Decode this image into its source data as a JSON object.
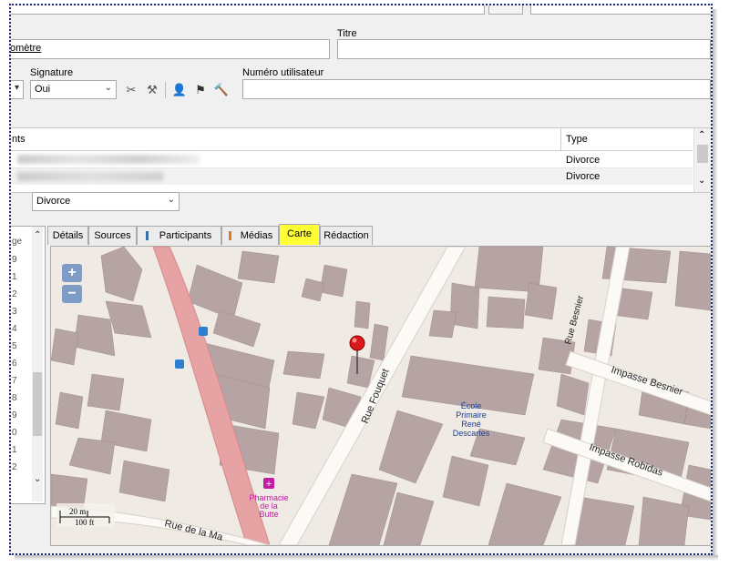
{
  "form": {
    "field_partial_value": "omètre",
    "titre_label": "Titre",
    "titre_value": "",
    "signature_label": "Signature",
    "signature_value": "Oui",
    "numero_label": "Numéro utilisateur",
    "numero_value": ""
  },
  "grid": {
    "col_partial": "nts",
    "col_type": "Type",
    "rows": [
      {
        "type": "Divorce"
      },
      {
        "type": "Divorce"
      }
    ],
    "filter_value": "Divorce"
  },
  "left_list": {
    "header": "ge",
    "items": [
      "9",
      "1",
      "2",
      "3",
      "4",
      "5",
      "6",
      "7",
      "8",
      "9",
      "0",
      "1",
      "2"
    ]
  },
  "tabs": [
    {
      "label": "Détails"
    },
    {
      "label": "Sources"
    },
    {
      "label": "Participants"
    },
    {
      "label": "Médias"
    },
    {
      "label": "Carte"
    },
    {
      "label": "Rédaction"
    }
  ],
  "active_tab": "Carte",
  "map": {
    "zoom_in": "+",
    "zoom_out": "−",
    "streets": {
      "fouquet": "Rue Fouquet",
      "besnier": "Rue Besnier",
      "impasse_besnier": "Impasse Besnier",
      "impasse_robidas": "Impasse Robidas",
      "rue_de_la_ma": "Rue de la Ma"
    },
    "poi": {
      "ecole": [
        "École",
        "Primaire",
        "René",
        "Descartes"
      ],
      "pharmacie": [
        "Pharmacie",
        "de la",
        "Butte"
      ]
    },
    "scale_m": "20 m",
    "scale_ft": "100 ft"
  },
  "colors": {
    "active_tab": "#ffff33",
    "map_bg": "#efeae3",
    "building": "#b6a3a3",
    "main_road": "#e7a3a3",
    "zoom_btn": "#7f9cc6"
  }
}
